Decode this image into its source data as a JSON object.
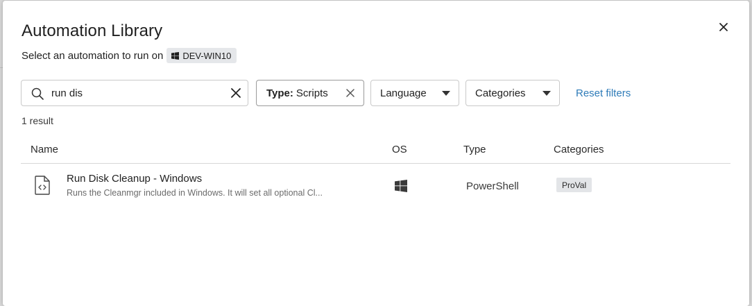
{
  "dialog": {
    "title": "Automation Library",
    "subtitle_prefix": "Select an automation to run on",
    "device_name": "DEV-WIN10"
  },
  "filters": {
    "search_value": "run dis",
    "type_label": "Type:",
    "type_value": "Scripts",
    "language_label": "Language",
    "categories_label": "Categories",
    "reset_label": "Reset filters"
  },
  "results": {
    "count_text": "1 result",
    "columns": [
      "Name",
      "OS",
      "Type",
      "Categories"
    ],
    "rows": [
      {
        "name": "Run Disk Cleanup - Windows",
        "description": "Runs the Cleanmgr included in Windows. It will set all optional Cl...",
        "os_icon": "windows-icon",
        "type": "PowerShell",
        "category": "ProVal"
      }
    ]
  },
  "colors": {
    "link": "#2e7bb8",
    "chip_bg": "#e3e5e8"
  }
}
